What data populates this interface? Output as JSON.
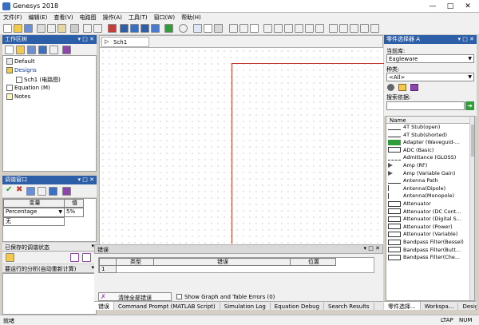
{
  "app": {
    "title": "Genesys 2018"
  },
  "menu": [
    "文件(F)",
    "编辑(E)",
    "查看(V)",
    "电路图",
    "操作(A)",
    "工具(T)",
    "窗口(W)",
    "帮助(H)"
  ],
  "workspace": {
    "title": "工作区树",
    "items": [
      {
        "label": "Default",
        "indent": 0
      },
      {
        "label": "Designs",
        "indent": 0
      },
      {
        "label": "Sch1 (电路图)",
        "indent": 1
      },
      {
        "label": "Equation (M)",
        "indent": 0
      },
      {
        "label": "Notes",
        "indent": 0
      }
    ]
  },
  "tuning": {
    "title": "调谐窗口",
    "col_var": "变量",
    "col_val": "值",
    "row_var": "Percentage",
    "row_val": "5%",
    "row2": "无",
    "saved_title": "已保存的调谐状态",
    "analysis_title": "要运行的分析(自动重新计算)"
  },
  "doc_tab": {
    "label": "Sch1"
  },
  "errors": {
    "title": "错误",
    "headers": [
      "类型",
      "错误",
      "位置"
    ],
    "row_num": "1",
    "clear_button": "清除全部错误",
    "checkbox_label": "Show Graph and Table Errors (0)",
    "tabs": [
      "错误",
      "Command Prompt (MATLAB Script)",
      "Simulation Log",
      "Equation Debug",
      "Search Results"
    ]
  },
  "library": {
    "title": "零件选择器 A",
    "current_lib_label": "当前库:",
    "current_lib": "Eagleware",
    "category_label": "种类:",
    "category": "<All>",
    "filter_label": "搜索依据:",
    "name_header": "Name",
    "parts": [
      "4T Stub(open)",
      "4T Stub(shorted)",
      "Adapter (Waveguid-...",
      "ADC (Basic)",
      "Admittance (GLOSS)",
      "Amp (RF)",
      "Amp (Variable Gain)",
      "Antenna Path",
      "Antenna(Dipole)",
      "Antenna(Monopole)",
      "Attenuator",
      "Attenuator (DC Cont...",
      "Attenuator (Digital S...",
      "Attenuator (Power)",
      "Attenuator (Variable)",
      "Bandpass Filter(Bessel)",
      "Bandpass Filter(Butt...",
      "Bandpass Filter(Che..."
    ],
    "bottom_tabs": [
      "零件选择...",
      "Workspa...",
      "Design V..."
    ]
  },
  "status": {
    "left": "就绪",
    "ltap": "LTAP",
    "num": "NUM"
  },
  "colors": {
    "accent": "#2d5fa8",
    "schematic_line": "#c0392b"
  }
}
